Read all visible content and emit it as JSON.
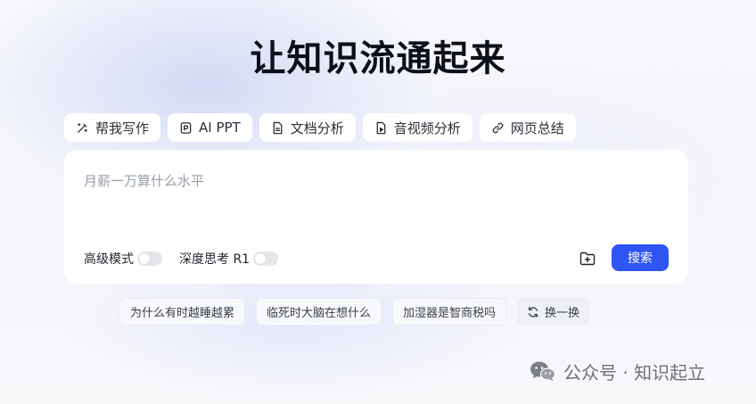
{
  "header": {
    "title": "让知识流通起来"
  },
  "tools": [
    {
      "label": "帮我写作",
      "icon": "magic-wand-icon"
    },
    {
      "label": "AI PPT",
      "icon": "ppt-icon"
    },
    {
      "label": "文档分析",
      "icon": "document-icon"
    },
    {
      "label": "音视频分析",
      "icon": "media-file-icon"
    },
    {
      "label": "网页总结",
      "icon": "link-icon"
    }
  ],
  "search": {
    "placeholder": "月薪一万算什么水平",
    "value": "",
    "advanced_mode_label": "高级模式",
    "advanced_mode_on": false,
    "deep_think_label": "深度思考 R1",
    "deep_think_on": false,
    "upload_icon": "folder-plus-icon",
    "submit_label": "搜索"
  },
  "suggestions": [
    "为什么有时越睡越累",
    "临死时大脑在想什么",
    "加湿器是智商税吗"
  ],
  "refresh": {
    "label": "换一换",
    "icon": "refresh-icon"
  },
  "watermark": {
    "text": "公众号 · 知识起立",
    "icon": "wechat-icon"
  },
  "colors": {
    "accent": "#2f55f5",
    "title": "#0d0f1a",
    "placeholder": "#9aa0a8"
  }
}
